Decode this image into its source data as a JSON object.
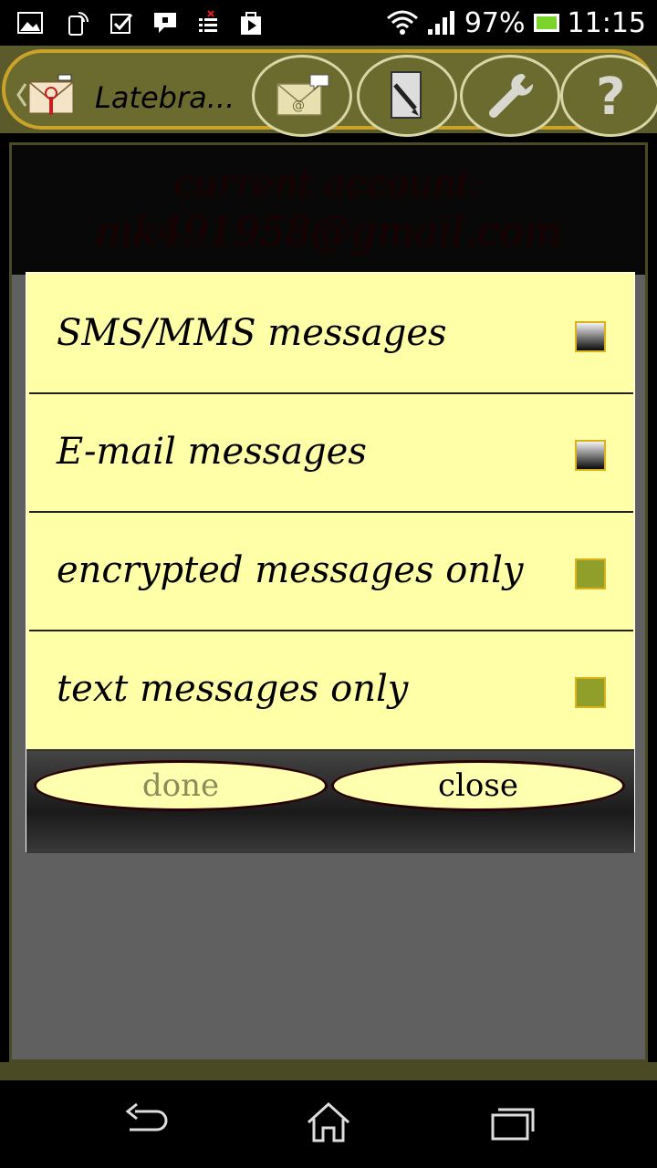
{
  "status_bar": {
    "battery": "97%",
    "time": "11:15",
    "icons": [
      "gallery-icon",
      "cast-icon",
      "checkbox-icon",
      "chat-icon",
      "sms-blocked-icon",
      "play-store-icon",
      "wifi-icon",
      "signal-icon",
      "battery-icon"
    ]
  },
  "action_bar": {
    "title": "Latebra...",
    "buttons": [
      "sms-email-icon",
      "edit-icon",
      "settings-wrench-icon",
      "help-icon"
    ]
  },
  "content": {
    "account_label": "current account:",
    "account_email": "mk491958@gmail.com"
  },
  "dialog": {
    "options": [
      {
        "label": "SMS/MMS messages",
        "checked": false
      },
      {
        "label": "E-mail messages",
        "checked": false
      },
      {
        "label": "encrypted messages only",
        "checked": true
      },
      {
        "label": "text messages only",
        "checked": true
      }
    ],
    "done_label": "done",
    "close_label": "close"
  },
  "colors": {
    "dialog_bg": "#ffffa8",
    "accent_gold": "#c9a428",
    "checked": "#8f9f2a"
  },
  "nav_bar": {
    "icons": [
      "back-icon",
      "home-icon",
      "recents-icon"
    ]
  }
}
